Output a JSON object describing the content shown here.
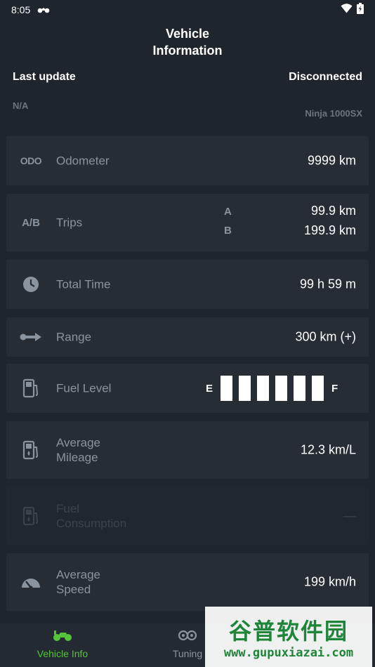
{
  "status_bar": {
    "time": "8:05"
  },
  "header": {
    "title_line1": "Vehicle",
    "title_line2": "Information"
  },
  "info": {
    "last_update_label": "Last update",
    "last_update_value": "N/A",
    "connection_status": "Disconnected",
    "model": "Ninja 1000SX"
  },
  "cards": {
    "odometer": {
      "icon_text": "ODO",
      "label": "Odometer",
      "value": "9999 km"
    },
    "trips": {
      "icon_text": "A/B",
      "label": "Trips",
      "letter_a": "A",
      "letter_b": "B",
      "value_a": "99.9 km",
      "value_b": "199.9 km"
    },
    "total_time": {
      "label": "Total Time",
      "value": "99 h 59 m"
    },
    "range": {
      "label": "Range",
      "value": "300 km (+)"
    },
    "fuel_level": {
      "label": "Fuel Level",
      "empty_mark": "E",
      "full_mark": "F",
      "bars_filled": 6,
      "bars_total": 6
    },
    "average_mileage": {
      "label_line1": "Average",
      "label_line2": "Mileage",
      "value": "12.3 km/L"
    },
    "fuel_consumption": {
      "label_line1": "Fuel",
      "label_line2": "Consumption",
      "value": "—"
    },
    "average_speed": {
      "label_line1": "Average",
      "label_line2": "Speed",
      "value": "199 km/h"
    }
  },
  "bottom_nav": {
    "vehicle_info": "Vehicle Info",
    "tuning": "Tuning"
  },
  "watermark": {
    "title": "谷普软件园",
    "url": "www.gupuxiazai.com"
  },
  "colors": {
    "background": "#1e252c",
    "card": "#262d35",
    "accent": "#55c43b",
    "muted": "#8a949e"
  }
}
